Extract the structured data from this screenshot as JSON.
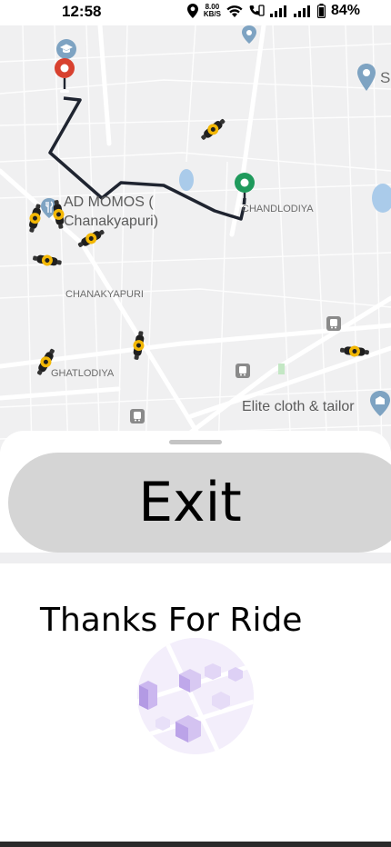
{
  "status_bar": {
    "time": "12:58",
    "speed_value": "8.00",
    "speed_unit": "KB/S",
    "battery": "84%"
  },
  "map": {
    "labels": {
      "restaurant": "AD MOMOS (",
      "restaurant_line2": "Chanakyapuri)",
      "chandlodiya": "CHANDLODIYA",
      "chanakyapuri": "CHANAKYAPURI",
      "ghatlodiya": "GHATLODIYA",
      "elite": "Elite cloth & tailor",
      "edge_label": "S"
    },
    "colors": {
      "route": "#1f2430",
      "pickup_pin": "#d8412f",
      "drop_pin": "#1f9a5c",
      "scooter": "#f2b705",
      "poi": "#7ea3c2"
    }
  },
  "sheet": {
    "exit_label": "Exit"
  },
  "card": {
    "thanks_text": "Thanks For Ride"
  }
}
